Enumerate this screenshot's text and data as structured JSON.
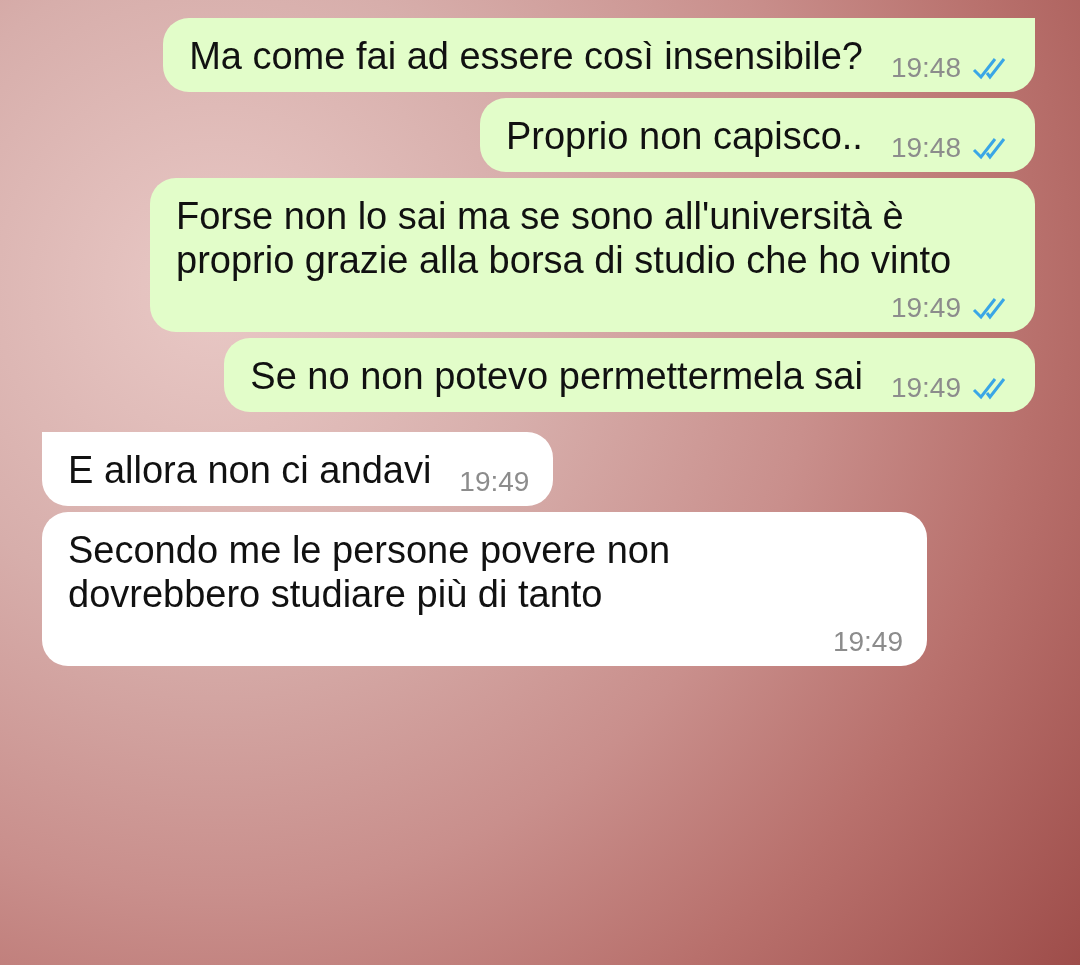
{
  "messages": [
    {
      "kind": "sent",
      "text": "Ma come fai ad essere così insensibile?",
      "time": "19:48",
      "read": true,
      "tail": true
    },
    {
      "kind": "sent",
      "text": "Proprio non capisco..",
      "time": "19:48",
      "read": true,
      "tail": false
    },
    {
      "kind": "sent",
      "text": "Forse non lo sai ma se sono all'università è proprio grazie alla borsa di studio che ho vinto",
      "time": "19:49",
      "read": true,
      "tail": false
    },
    {
      "kind": "sent",
      "text": "Se no non potevo permettermela sai",
      "time": "19:49",
      "read": true,
      "tail": false
    },
    {
      "kind": "received",
      "text": "E allora non ci andavi",
      "time": "19:49",
      "tail": true
    },
    {
      "kind": "received",
      "text": "Secondo me le persone povere non dovrebbero studiare più di tanto",
      "time": "19:49",
      "tail": false
    }
  ]
}
